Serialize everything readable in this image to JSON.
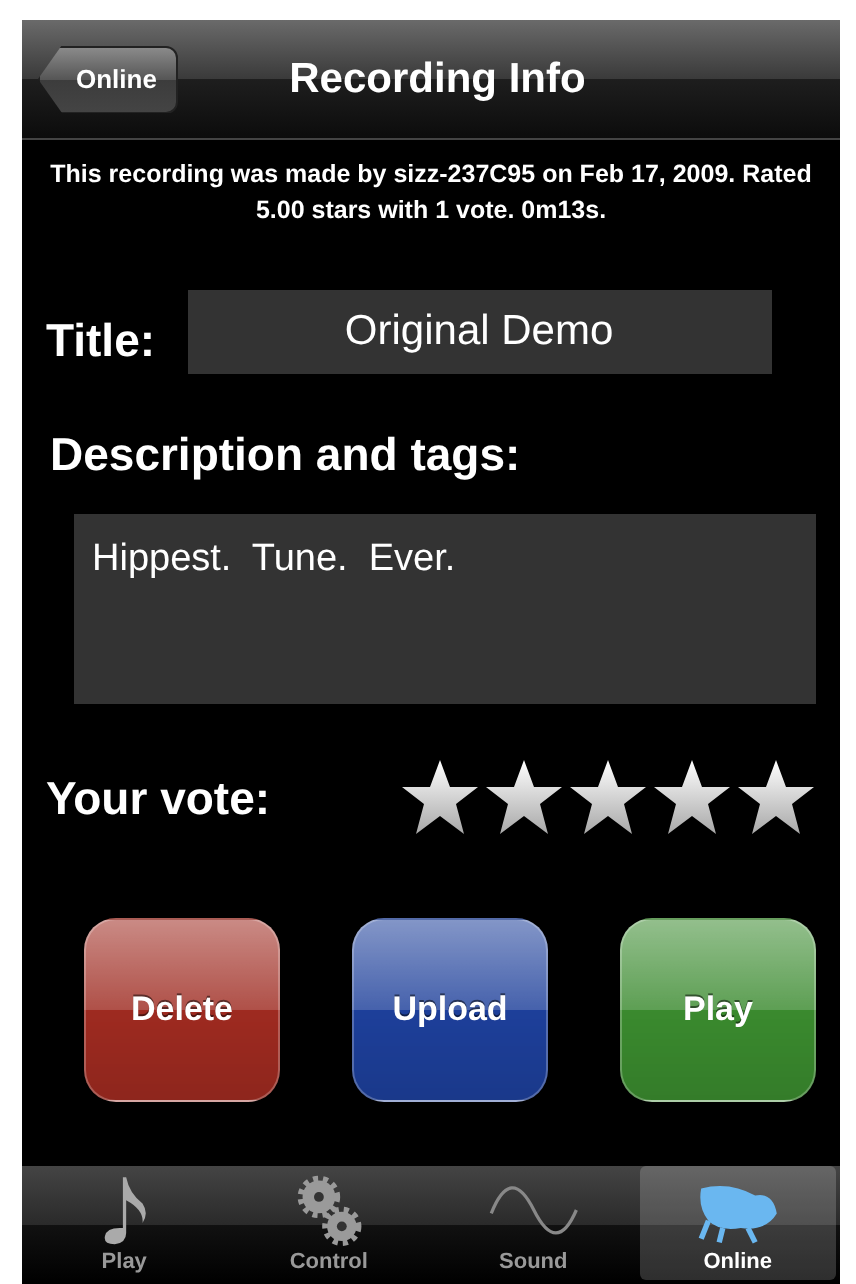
{
  "nav_bar": {
    "back_button": "Online",
    "title": "Recording Info"
  },
  "info": "This recording was made by sizz-237C95 on Feb 17, 2009. Rated 5.00 stars with 1 vote. 0m13s.",
  "title_field": {
    "label": "Title:",
    "value": "Original Demo"
  },
  "description": {
    "label": "Description and tags:",
    "value": "Hippest.  Tune.  Ever."
  },
  "vote": {
    "label": "Your vote:",
    "stars": 5
  },
  "buttons": [
    {
      "label": "Delete",
      "color": "#9e2a20"
    },
    {
      "label": "Upload",
      "color": "#1d3f9a"
    },
    {
      "label": "Play",
      "color": "#3a8a2e"
    }
  ],
  "tabs": [
    {
      "label": "Play",
      "kind": "note",
      "selected": false
    },
    {
      "label": "Control",
      "kind": "gears",
      "selected": false
    },
    {
      "label": "Sound",
      "kind": "wave",
      "selected": false
    },
    {
      "label": "Online",
      "kind": "frog",
      "selected": true
    }
  ]
}
